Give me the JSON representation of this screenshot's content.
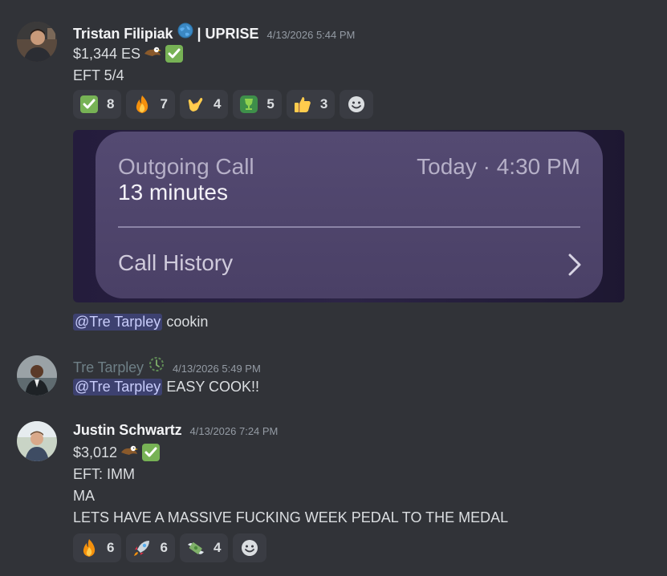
{
  "messages": [
    {
      "username": "Tristan Filipiak",
      "badge_icon": "globe-icon",
      "tag": "| UPRISE",
      "timestamp": "4/13/2026 5:44 PM",
      "lines": [
        "$1,344 ES",
        "EFT 5/4"
      ],
      "inline_icons": [
        "eagle-icon",
        "check-mark-icon"
      ],
      "reactions": [
        {
          "emoji": "check-mark-icon",
          "count": "8"
        },
        {
          "emoji": "fire-icon",
          "count": "7"
        },
        {
          "emoji": "call-me-hand-icon",
          "count": "4"
        },
        {
          "emoji": "trophy-icon",
          "count": "5"
        },
        {
          "emoji": "thumbs-up-icon",
          "count": "3"
        }
      ],
      "attachment": {
        "title": "Outgoing Call",
        "duration": "13 minutes",
        "time": "Today · 4:30 PM",
        "history_label": "Call History"
      },
      "followup": {
        "mention": "@Tre Tarpley",
        "text": "cookin"
      }
    },
    {
      "username": "Tre Tarpley",
      "badge_icon": "clock-badge-icon",
      "timestamp": "4/13/2026 5:49 PM",
      "mention": "@Tre Tarpley",
      "text": "EASY COOK!!"
    },
    {
      "username": "Justin Schwartz",
      "timestamp": "4/13/2026 7:24 PM",
      "lines": [
        "$3,012",
        "EFT: IMM",
        "MA",
        "LETS HAVE A MASSIVE FUCKING WEEK PEDAL TO THE MEDAL"
      ],
      "inline_icons": [
        "eagle-icon",
        "check-mark-icon"
      ],
      "reactions": [
        {
          "emoji": "fire-icon",
          "count": "6"
        },
        {
          "emoji": "rocket-icon",
          "count": "6"
        },
        {
          "emoji": "money-wings-icon",
          "count": "4"
        }
      ]
    }
  ],
  "colors": {
    "background": "#313338",
    "mention_bg": "#3c4270",
    "reaction_bg": "#3a3c43"
  }
}
